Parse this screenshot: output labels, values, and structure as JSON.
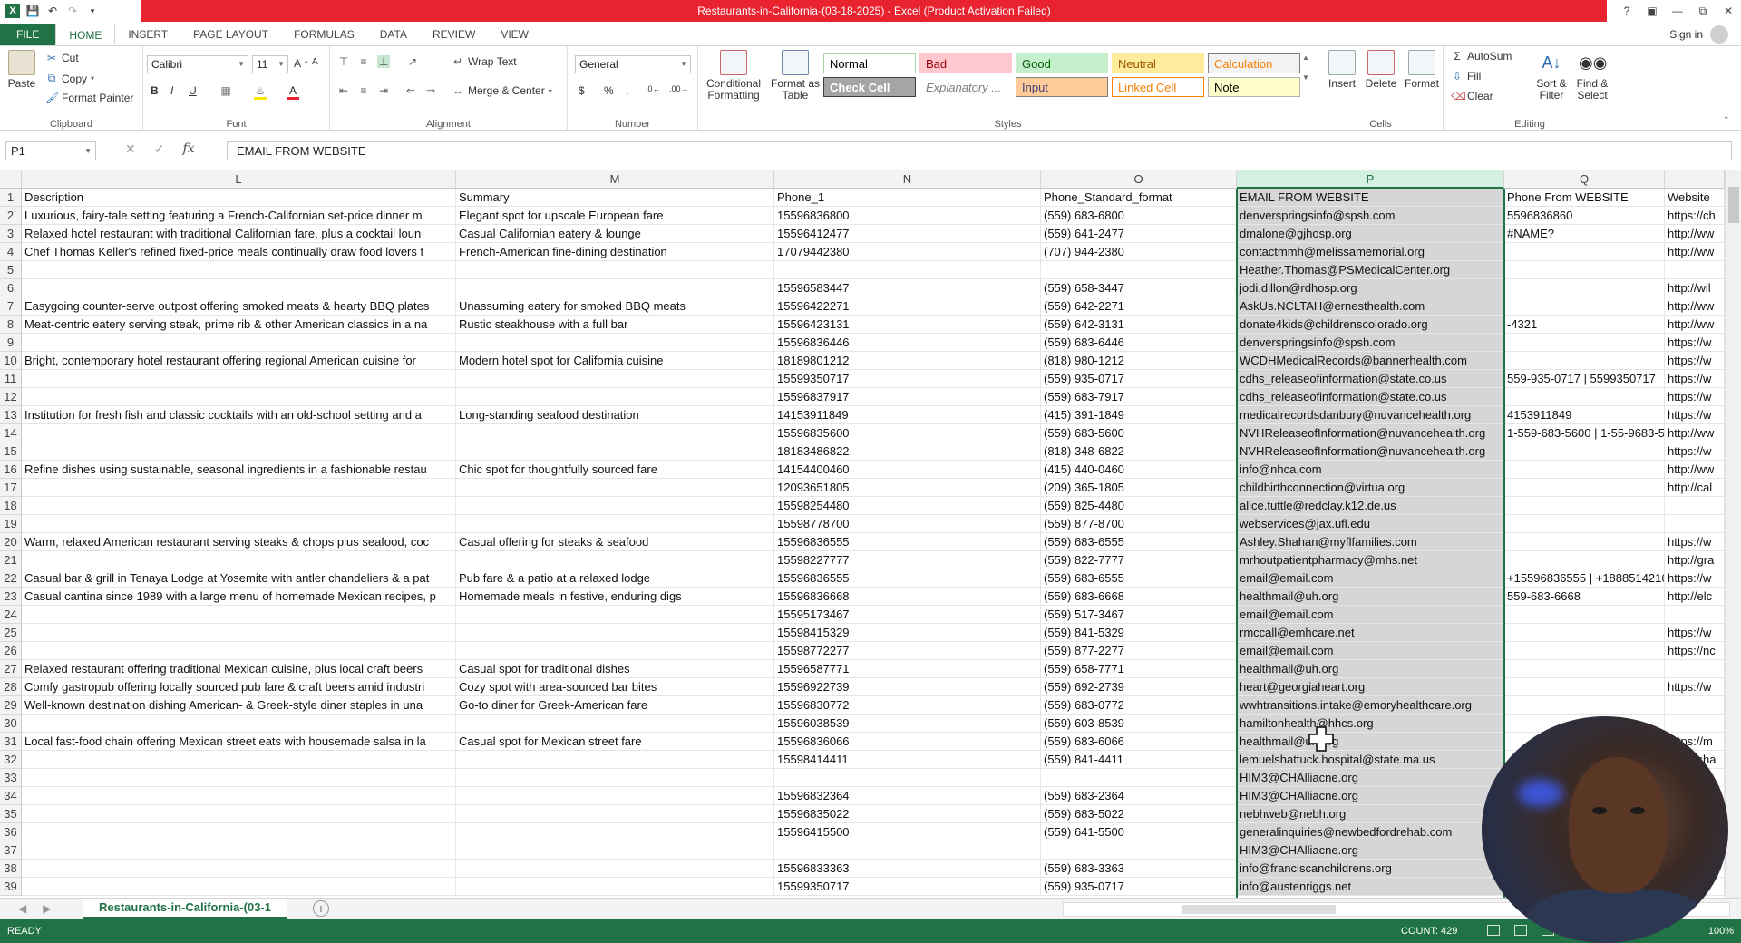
{
  "app": {
    "title": "Restaurants-in-California-(03-18-2025) -  Excel (Product Activation Failed)",
    "signin": "Sign in"
  },
  "tabs": [
    "FILE",
    "HOME",
    "INSERT",
    "PAGE LAYOUT",
    "FORMULAS",
    "DATA",
    "REVIEW",
    "VIEW"
  ],
  "ribbon": {
    "paste": "Paste",
    "cut": "Cut",
    "copy": "Copy",
    "format_painter": "Format Painter",
    "clipboard": "Clipboard",
    "font_name": "Calibri",
    "font_size": "11",
    "font": "Font",
    "wrap_text": "Wrap Text",
    "merge_center": "Merge & Center",
    "alignment": "Alignment",
    "number_format": "General",
    "number": "Number",
    "conditional_formatting": "Conditional Formatting",
    "format_as_table": "Format as Table",
    "styles": "Styles",
    "style_cells": [
      {
        "label": "Normal",
        "bg": "#ffffff",
        "fg": "#000000",
        "border": "#a6d7a6"
      },
      {
        "label": "Bad",
        "bg": "#ffc7ce",
        "fg": "#9c0006",
        "border": "#ffc7ce"
      },
      {
        "label": "Good",
        "bg": "#c6efce",
        "fg": "#006100",
        "border": "#c6efce"
      },
      {
        "label": "Neutral",
        "bg": "#ffeb9c",
        "fg": "#9c5700",
        "border": "#ffeb9c"
      },
      {
        "label": "Calculation",
        "bg": "#f2f2f2",
        "fg": "#fa7d00",
        "border": "#7f7f7f"
      },
      {
        "label": "Check Cell",
        "bg": "#a5a5a5",
        "fg": "#ffffff",
        "border": "#3f3f3f"
      },
      {
        "label": "Explanatory ...",
        "bg": "#ffffff",
        "fg": "#7f7f7f",
        "border": "#ffffff"
      },
      {
        "label": "Input",
        "bg": "#ffcc99",
        "fg": "#3f3f76",
        "border": "#7f7f7f"
      },
      {
        "label": "Linked Cell",
        "bg": "#ffffff",
        "fg": "#fa7d00",
        "border": "#ff8001"
      },
      {
        "label": "Note",
        "bg": "#ffffcc",
        "fg": "#000000",
        "border": "#b2b2b2"
      }
    ],
    "insert": "Insert",
    "delete": "Delete",
    "format": "Format",
    "cells": "Cells",
    "autosum": "AutoSum",
    "fill": "Fill",
    "clear": "Clear",
    "sort_filter": "Sort & Filter",
    "find_select": "Find & Select",
    "editing": "Editing"
  },
  "formula_bar": {
    "name_box": "P1",
    "formula": "EMAIL FROM WEBSITE"
  },
  "grid": {
    "columns": [
      {
        "letter": "L",
        "header": "Description"
      },
      {
        "letter": "M",
        "header": "Summary"
      },
      {
        "letter": "N",
        "header": "Phone_1"
      },
      {
        "letter": "O",
        "header": "Phone_Standard_format"
      },
      {
        "letter": "P",
        "header": "EMAIL FROM WEBSITE"
      },
      {
        "letter": "Q",
        "header": "Phone From WEBSITE"
      },
      {
        "letter": "",
        "header": "Website"
      }
    ],
    "selected_column": "P",
    "rows": [
      [
        "Luxurious, fairy-tale setting featuring a French-Californian set-price dinner m",
        "Elegant spot for upscale European fare",
        "15596836800",
        "(559) 683-6800",
        "denverspringsinfo@spsh.com",
        "5596836860",
        "https://ch"
      ],
      [
        "Relaxed hotel restaurant with traditional Californian fare, plus a cocktail loun",
        "Casual Californian eatery & lounge",
        "15596412477",
        "(559) 641-2477",
        "dmalone@gjhosp.org",
        "#NAME?",
        "http://ww"
      ],
      [
        "Chef Thomas Keller's refined fixed-price meals continually draw food lovers t",
        "French-American fine-dining destination",
        "17079442380",
        "(707) 944-2380",
        "contactmmh@melissamemorial.org",
        "",
        "http://ww"
      ],
      [
        "",
        "",
        "",
        "",
        "Heather.Thomas@PSMedicalCenter.org",
        "",
        ""
      ],
      [
        "",
        "",
        "15596583447",
        "(559) 658-3447",
        "jodi.dillon@rdhosp.org",
        "",
        "http://wil"
      ],
      [
        "Easygoing counter-serve outpost offering smoked meats & hearty BBQ plates",
        "Unassuming eatery for smoked BBQ meats",
        "15596422271",
        "(559) 642-2271",
        "AskUs.NCLTAH@ernesthealth.com",
        "",
        "http://ww"
      ],
      [
        "Meat-centric eatery serving steak, prime rib & other American classics in a na",
        "Rustic steakhouse with a full bar",
        "15596423131",
        "(559) 642-3131",
        "donate4kids@childrenscolorado.org",
        "-4321",
        "http://ww"
      ],
      [
        "",
        "",
        "15596836446",
        "(559) 683-6446",
        "denverspringsinfo@spsh.com",
        "",
        "https://w"
      ],
      [
        "Bright, contemporary hotel restaurant offering regional American cuisine for",
        "Modern hotel spot for California cuisine",
        "18189801212",
        "(818) 980-1212",
        "WCDHMedicalRecords@bannerhealth.com",
        "",
        "https://w"
      ],
      [
        "",
        "",
        "15599350717",
        "(559) 935-0717",
        "cdhs_releaseofinformation@state.co.us",
        "559-935-0717 | 5599350717",
        "https://w"
      ],
      [
        "",
        "",
        "15596837917",
        "(559) 683-7917",
        "cdhs_releaseofinformation@state.co.us",
        "",
        "https://w"
      ],
      [
        "Institution for fresh fish and classic cocktails with an old-school setting and a",
        "Long-standing seafood destination",
        "14153911849",
        "(415) 391-1849",
        "medicalrecordsdanbury@nuvancehealth.org",
        "4153911849",
        "https://w"
      ],
      [
        "",
        "",
        "15596835600",
        "(559) 683-5600",
        "NVHReleaseofInformation@nuvancehealth.org",
        "1-559-683-5600 | 1-55-9683-5",
        "http://ww"
      ],
      [
        "",
        "",
        "18183486822",
        "(818) 348-6822",
        "NVHReleaseofInformation@nuvancehealth.org",
        "",
        "https://w"
      ],
      [
        "Refine dishes using sustainable, seasonal ingredients in a fashionable restau",
        "Chic spot for thoughtfully sourced fare",
        "14154400460",
        "(415) 440-0460",
        "info@nhca.com",
        "",
        "http://ww"
      ],
      [
        "",
        "",
        "12093651805",
        "(209) 365-1805",
        "childbirthconnection@virtua.org",
        "",
        "http://cal"
      ],
      [
        "",
        "",
        "15598254480",
        "(559) 825-4480",
        "alice.tuttle@redclay.k12.de.us",
        "",
        ""
      ],
      [
        "",
        "",
        "15598778700",
        "(559) 877-8700",
        "webservices@jax.ufl.edu",
        "",
        ""
      ],
      [
        "Warm, relaxed American restaurant serving steaks & chops plus seafood, coc",
        "Casual offering for steaks & seafood",
        "15596836555",
        "(559) 683-6555",
        "Ashley.Shahan@myflfamilies.com",
        "",
        "https://w"
      ],
      [
        "",
        "",
        "15598227777",
        "(559) 822-7777",
        "mrhoutpatientpharmacy@mhs.net",
        "",
        "http://gra"
      ],
      [
        "Casual bar & grill in Tenaya Lodge at Yosemite with antler chandeliers & a pat",
        "Pub fare & a patio at a relaxed lodge",
        "15596836555",
        "(559) 683-6555",
        "email@email.com",
        "+15596836555 | +1888514216",
        "https://w"
      ],
      [
        "Casual cantina since 1989 with a large menu of homemade Mexican recipes, p",
        "Homemade meals in festive, enduring digs",
        "15596836668",
        "(559) 683-6668",
        "healthmail@uh.org",
        "559-683-6668",
        "http://elc"
      ],
      [
        "",
        "",
        "15595173467",
        "(559) 517-3467",
        "email@email.com",
        "",
        ""
      ],
      [
        "",
        "",
        "15598415329",
        "(559) 841-5329",
        "rmccall@emhcare.net",
        "",
        "https://w"
      ],
      [
        "",
        "",
        "15598772277",
        "(559) 877-2277",
        "email@email.com",
        "",
        "https://nc"
      ],
      [
        "Relaxed restaurant offering traditional Mexican cuisine, plus local craft beers",
        "Casual spot for traditional dishes",
        "15596587771",
        "(559) 658-7771",
        "healthmail@uh.org",
        "",
        ""
      ],
      [
        "Comfy gastropub offering locally sourced pub fare & craft beers amid industri",
        "Cozy spot with area-sourced bar bites",
        "15596922739",
        "(559) 692-2739",
        "heart@georgiaheart.org",
        "",
        "https://w"
      ],
      [
        "Well-known destination dishing American- & Greek-style diner staples in una",
        "Go-to diner for Greek-American fare",
        "15596830772",
        "(559) 683-0772",
        "wwhtransitions.intake@emoryhealthcare.org",
        "",
        ""
      ],
      [
        "",
        "",
        "15596038539",
        "(559) 603-8539",
        "hamiltonhealth@hhcs.org",
        "",
        ""
      ],
      [
        "Local fast-food chain offering Mexican street eats with housemade salsa in la",
        "Casual spot for Mexican street fare",
        "15596836066",
        "(559) 683-6066",
        "healthmail@uh.org",
        "",
        "https://m"
      ],
      [
        "",
        "",
        "15598414411",
        "(559) 841-4411",
        "lemuelshattuck.hospital@state.ma.us",
        "",
        "http://sha"
      ],
      [
        "",
        "",
        "",
        "",
        "HIM3@CHAlliacne.org",
        "",
        ""
      ],
      [
        "",
        "",
        "15596832364",
        "(559) 683-2364",
        "HIM3@CHAlliacne.org",
        "",
        ""
      ],
      [
        "",
        "",
        "15596835022",
        "(559) 683-5022",
        "nebhweb@nebh.org",
        "",
        ""
      ],
      [
        "",
        "",
        "15596415500",
        "(559) 641-5500",
        "generalinquiries@newbedfordrehab.com",
        "",
        ""
      ],
      [
        "",
        "",
        "",
        "",
        "HIM3@CHAlliacne.org",
        "",
        ""
      ],
      [
        "",
        "",
        "15596833363",
        "(559) 683-3363",
        "info@franciscanchildrens.org",
        "",
        ""
      ],
      [
        "",
        "",
        "15599350717",
        "(559) 935-0717",
        "info@austenriggs.net",
        "",
        ""
      ]
    ]
  },
  "sheet": {
    "tab": "Restaurants-in-California-(03-1",
    "add": "+"
  },
  "status": {
    "ready": "READY",
    "count": "COUNT: 429",
    "zoom": "100%"
  }
}
